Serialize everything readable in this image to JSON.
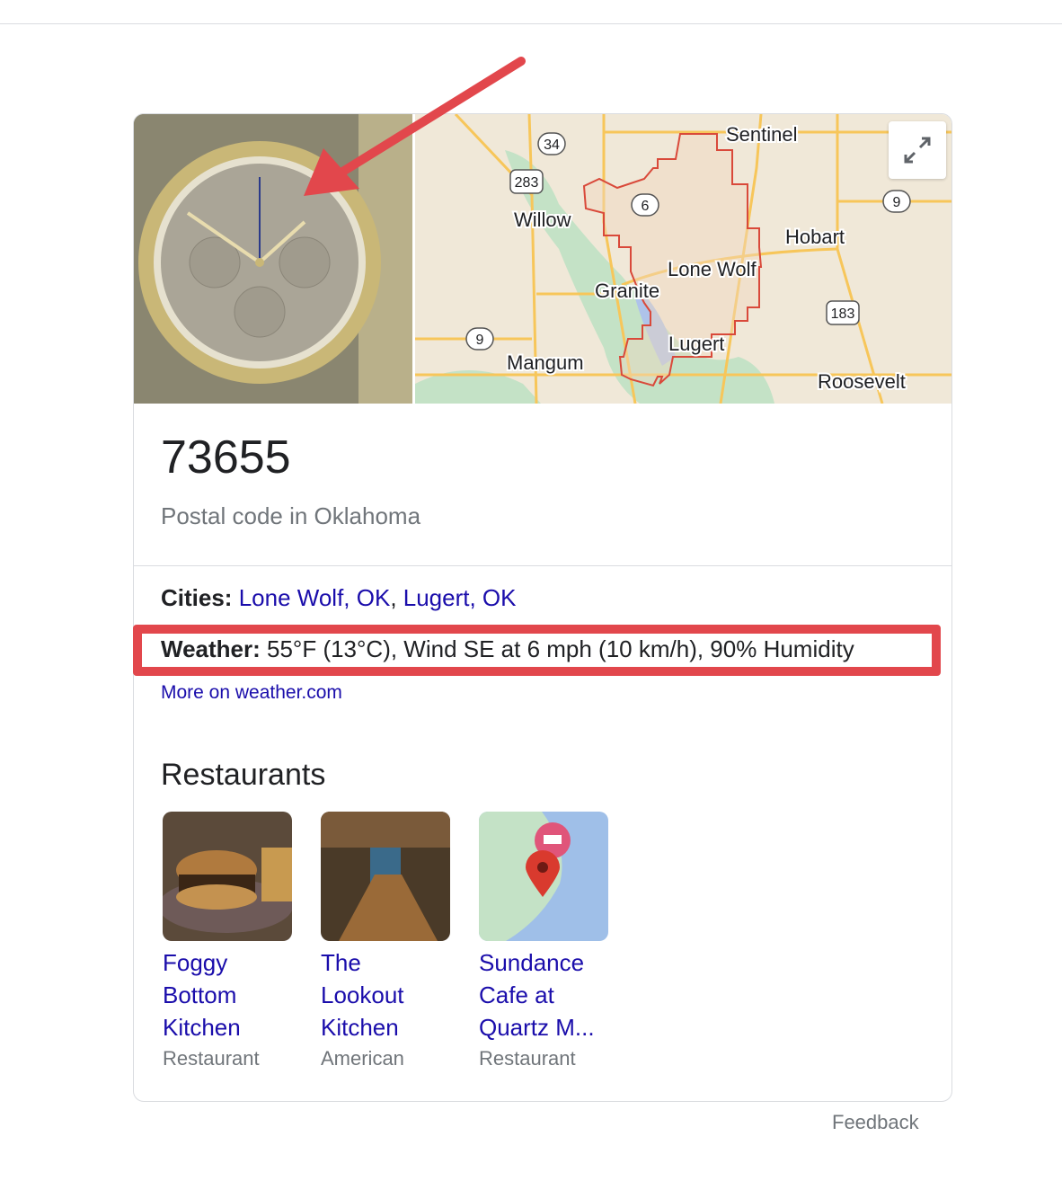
{
  "header": {
    "title": "73655",
    "subtitle": "Postal code in Oklahoma"
  },
  "map": {
    "labels": [
      "Sentinel",
      "Willow",
      "Hobart",
      "Lone Wolf",
      "Granite",
      "Lugert",
      "Mangum",
      "Roosevelt"
    ],
    "shields": [
      "34",
      "283",
      "6",
      "9",
      "183",
      "9"
    ],
    "expand_icon": "expand-arrows-icon"
  },
  "cities": {
    "label": "Cities:",
    "items": [
      "Lone Wolf, OK",
      "Lugert, OK"
    ],
    "separator": ", "
  },
  "weather": {
    "label": "Weather:",
    "value": "55°F (13°C), Wind SE at 6 mph (10 km/h), 90% Humidity",
    "more_link": "More on weather.com"
  },
  "restaurants": {
    "heading": "Restaurants",
    "items": [
      {
        "name": "Foggy Bottom Kitchen",
        "type": "Restaurant"
      },
      {
        "name": "The Lookout Kitchen",
        "type": "American"
      },
      {
        "name": "Sundance Cafe at Quartz M...",
        "type": "Restaurant"
      }
    ]
  },
  "footer": {
    "feedback": "Feedback"
  },
  "colors": {
    "annotation": "#e2474c",
    "link": "#1a0dab",
    "map_bg": "#f0e8d8"
  }
}
